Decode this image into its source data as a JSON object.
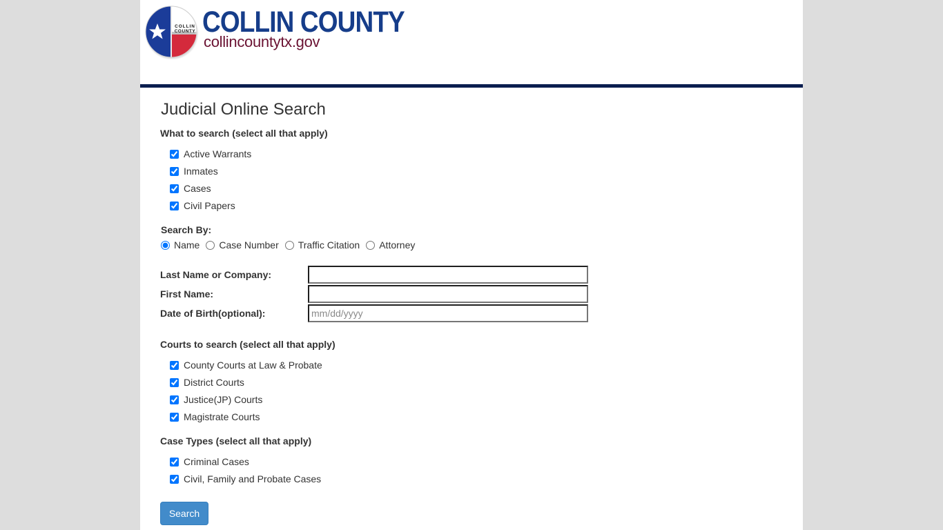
{
  "header": {
    "seal_text_line1": "COLLIN",
    "seal_text_line2": "COUNTY",
    "brand_title": "COLLIN COUNTY",
    "brand_url": "collincountytx.gov",
    "colors": {
      "brand_navy": "#163d8a",
      "brand_maroon": "#6a1232",
      "header_bar": "#0b1e4f",
      "seal_blue": "#1b3c99",
      "seal_red": "#d42a3c"
    }
  },
  "page_title": "Judicial Online Search",
  "what_to_search": {
    "label": "What to search (select all that apply)",
    "options": [
      {
        "label": "Active Warrants",
        "checked": true
      },
      {
        "label": "Inmates",
        "checked": true
      },
      {
        "label": "Cases",
        "checked": true
      },
      {
        "label": "Civil Papers",
        "checked": true
      }
    ]
  },
  "search_by": {
    "label": "Search By:",
    "options": [
      {
        "label": "Name",
        "selected": true
      },
      {
        "label": "Case Number",
        "selected": false
      },
      {
        "label": "Traffic Citation",
        "selected": false
      },
      {
        "label": "Attorney",
        "selected": false
      }
    ]
  },
  "fields": {
    "last_name": {
      "label": "Last Name or Company:",
      "value": "",
      "placeholder": ""
    },
    "first_name": {
      "label": "First Name:",
      "value": "",
      "placeholder": ""
    },
    "dob": {
      "label": "Date of Birth(optional):",
      "value": "",
      "placeholder": "mm/dd/yyyy"
    }
  },
  "courts": {
    "label": "Courts to search (select all that apply)",
    "options": [
      {
        "label": "County Courts at Law & Probate",
        "checked": true
      },
      {
        "label": "District Courts",
        "checked": true
      },
      {
        "label": "Justice(JP) Courts",
        "checked": true
      },
      {
        "label": "Magistrate Courts",
        "checked": true
      }
    ]
  },
  "case_types": {
    "label": "Case Types (select all that apply)",
    "options": [
      {
        "label": "Criminal Cases",
        "checked": true
      },
      {
        "label": "Civil, Family and Probate Cases",
        "checked": true
      }
    ]
  },
  "search_button": {
    "label": "Search",
    "color": "#428bca"
  }
}
